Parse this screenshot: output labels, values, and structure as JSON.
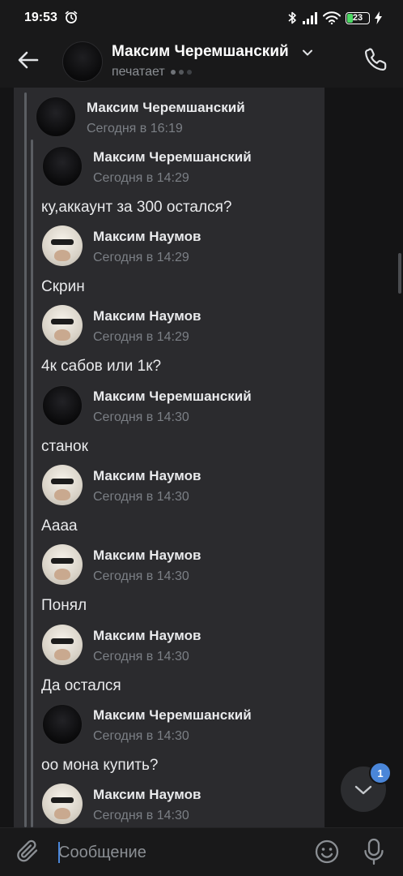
{
  "status_bar": {
    "time": "19:53",
    "battery": "23"
  },
  "header": {
    "name": "Максим Черемшанский",
    "status": "печатает"
  },
  "forward": {
    "name": "Максим Черемшанский",
    "time": "Сегодня в 16:19"
  },
  "messages": [
    {
      "name": "Максим Черемшанский",
      "time": "Сегодня в 14:29",
      "text": "ку,аккаунт за 300 остался?",
      "avatar": "dark"
    },
    {
      "name": "Максим Наумов",
      "time": "Сегодня в 14:29",
      "text": "Скрин",
      "avatar": "light"
    },
    {
      "name": "Максим Наумов",
      "time": "Сегодня в 14:29",
      "text": "4к сабов или 1к?",
      "avatar": "light"
    },
    {
      "name": "Максим Черемшанский",
      "time": "Сегодня в 14:30",
      "text": "станок",
      "avatar": "dark"
    },
    {
      "name": "Максим Наумов",
      "time": "Сегодня в 14:30",
      "text": "Аааа",
      "avatar": "light"
    },
    {
      "name": "Максим Наумов",
      "time": "Сегодня в 14:30",
      "text": "Понял",
      "avatar": "light"
    },
    {
      "name": "Максим Наумов",
      "time": "Сегодня в 14:30",
      "text": "Да остался",
      "avatar": "light"
    },
    {
      "name": "Максим Черемшанский",
      "time": "Сегодня в 14:30",
      "text": "оо мона купить?",
      "avatar": "dark"
    },
    {
      "name": "Максим Наумов",
      "time": "Сегодня в 14:30",
      "text": "",
      "avatar": "light"
    }
  ],
  "scroll_button": {
    "badge": "1"
  },
  "composer": {
    "placeholder": "Сообщение"
  },
  "colors": {
    "accent": "#4a86d9",
    "panel": "#2b2b2e",
    "background": "#19191a"
  },
  "icons": [
    "alarm-icon",
    "bluetooth-icon",
    "signal-icon",
    "wifi-icon",
    "battery-icon",
    "charging-icon",
    "back-arrow-icon",
    "chevron-down-icon",
    "phone-icon",
    "paperclip-icon",
    "emoji-icon",
    "microphone-icon"
  ]
}
